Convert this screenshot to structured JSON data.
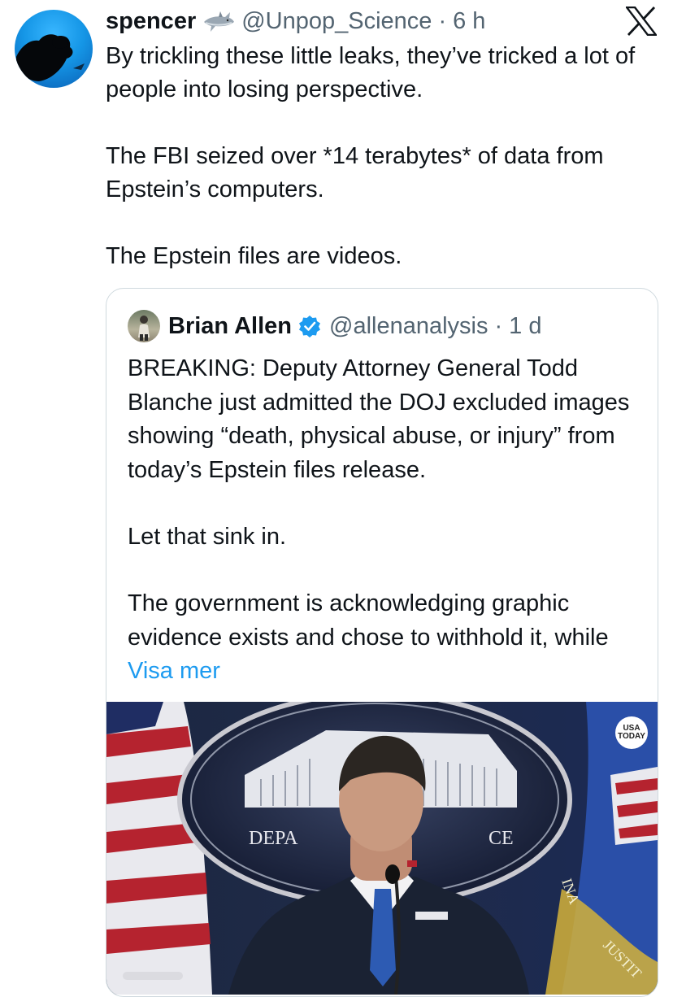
{
  "post": {
    "author_name": "spencer",
    "author_emoji_icon": "shark-icon",
    "author_handle": "@Unpop_Science",
    "separator": "·",
    "time": "6 h",
    "paragraphs": [
      "By trickling these little leaks, they’ve tricked a lot of people into losing perspective.",
      "The FBI seized over *14 terabytes* of data from Epstein’s computers.",
      "The Epstein files are videos."
    ]
  },
  "quoted_post": {
    "author_name": "Brian Allen",
    "verified_icon": "verified-badge-icon",
    "author_handle": "@allenanalysis",
    "separator": "·",
    "time": "1 d",
    "paragraphs": [
      "BREAKING: Deputy Attorney General Todd Blanche just admitted the DOJ excluded images showing “death, physical abuse, or injury” from today’s Epstein files release.",
      "Let that sink in.",
      "The government is acknowledging graphic evidence exists and chose to withhold it, while "
    ],
    "show_more_label": "Visa mer",
    "media": {
      "description_icon": "video-thumbnail",
      "watermark_text": "USA TODAY",
      "sign_left_text": "DEPA",
      "sign_right_text": "CE",
      "flag_text_a": "INA",
      "flag_text_b": "JUSTIT"
    }
  },
  "app_icon": "x-logo-icon",
  "colors": {
    "text": "#0f1419",
    "secondary": "#536471",
    "link": "#1d9bf0",
    "border": "#cfd9de",
    "verified": "#1d9bf0"
  }
}
